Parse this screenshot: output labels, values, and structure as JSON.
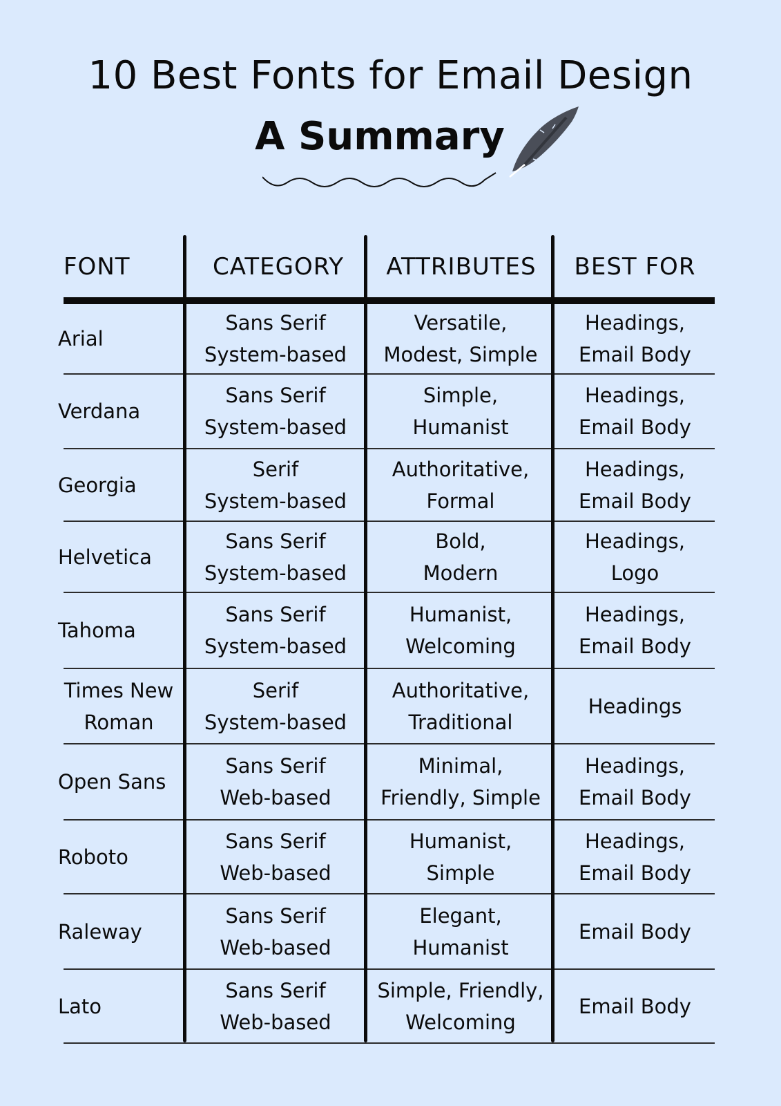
{
  "header": {
    "title": "10 Best Fonts for Email Design",
    "subtitle": "A Summary",
    "decoration_icons": [
      "feather-quill-icon",
      "squiggle-line"
    ]
  },
  "colors": {
    "background": "#dbeafd",
    "text": "#0b0b0b",
    "feather": "#4a4e58"
  },
  "table": {
    "columns": [
      "FONT",
      "CATEGORY",
      "ATTRIBUTES",
      "BEST FOR"
    ],
    "rows": [
      {
        "font": [
          "Arial"
        ],
        "category": [
          "Sans Serif",
          "System-based"
        ],
        "attributes": [
          "Versatile,",
          "Modest, Simple"
        ],
        "best_for": [
          "Headings,",
          "Email Body"
        ]
      },
      {
        "font": [
          "Verdana"
        ],
        "category": [
          "Sans Serif",
          "System-based"
        ],
        "attributes": [
          "Simple,",
          "Humanist"
        ],
        "best_for": [
          "Headings,",
          "Email Body"
        ]
      },
      {
        "font": [
          "Georgia"
        ],
        "category": [
          "Serif",
          "System-based"
        ],
        "attributes": [
          "Authoritative,",
          "Formal"
        ],
        "best_for": [
          "Headings,",
          "Email Body"
        ]
      },
      {
        "font": [
          "Helvetica"
        ],
        "category": [
          "Sans Serif",
          "System-based"
        ],
        "attributes": [
          "Bold,",
          "Modern"
        ],
        "best_for": [
          "Headings,",
          "Logo"
        ]
      },
      {
        "font": [
          "Tahoma"
        ],
        "category": [
          "Sans Serif",
          "System-based"
        ],
        "attributes": [
          "Humanist,",
          "Welcoming"
        ],
        "best_for": [
          "Headings,",
          "Email Body"
        ]
      },
      {
        "font": [
          "Times New",
          "Roman"
        ],
        "category": [
          "Serif",
          "System-based"
        ],
        "attributes": [
          "Authoritative,",
          "Traditional"
        ],
        "best_for": [
          "Headings"
        ]
      },
      {
        "font": [
          "Open Sans"
        ],
        "category": [
          "Sans Serif",
          "Web-based"
        ],
        "attributes": [
          "Minimal,",
          "Friendly, Simple"
        ],
        "best_for": [
          "Headings,",
          "Email Body"
        ]
      },
      {
        "font": [
          "Roboto"
        ],
        "category": [
          "Sans Serif",
          "Web-based"
        ],
        "attributes": [
          "Humanist,",
          "Simple"
        ],
        "best_for": [
          "Headings,",
          "Email Body"
        ]
      },
      {
        "font": [
          "Raleway"
        ],
        "category": [
          "Sans Serif",
          "Web-based"
        ],
        "attributes": [
          "Elegant,",
          "Humanist"
        ],
        "best_for": [
          "Email Body"
        ]
      },
      {
        "font": [
          "Lato"
        ],
        "category": [
          "Sans Serif",
          "Web-based"
        ],
        "attributes": [
          "Simple, Friendly,",
          "Welcoming"
        ],
        "best_for": [
          "Email Body"
        ]
      }
    ]
  }
}
